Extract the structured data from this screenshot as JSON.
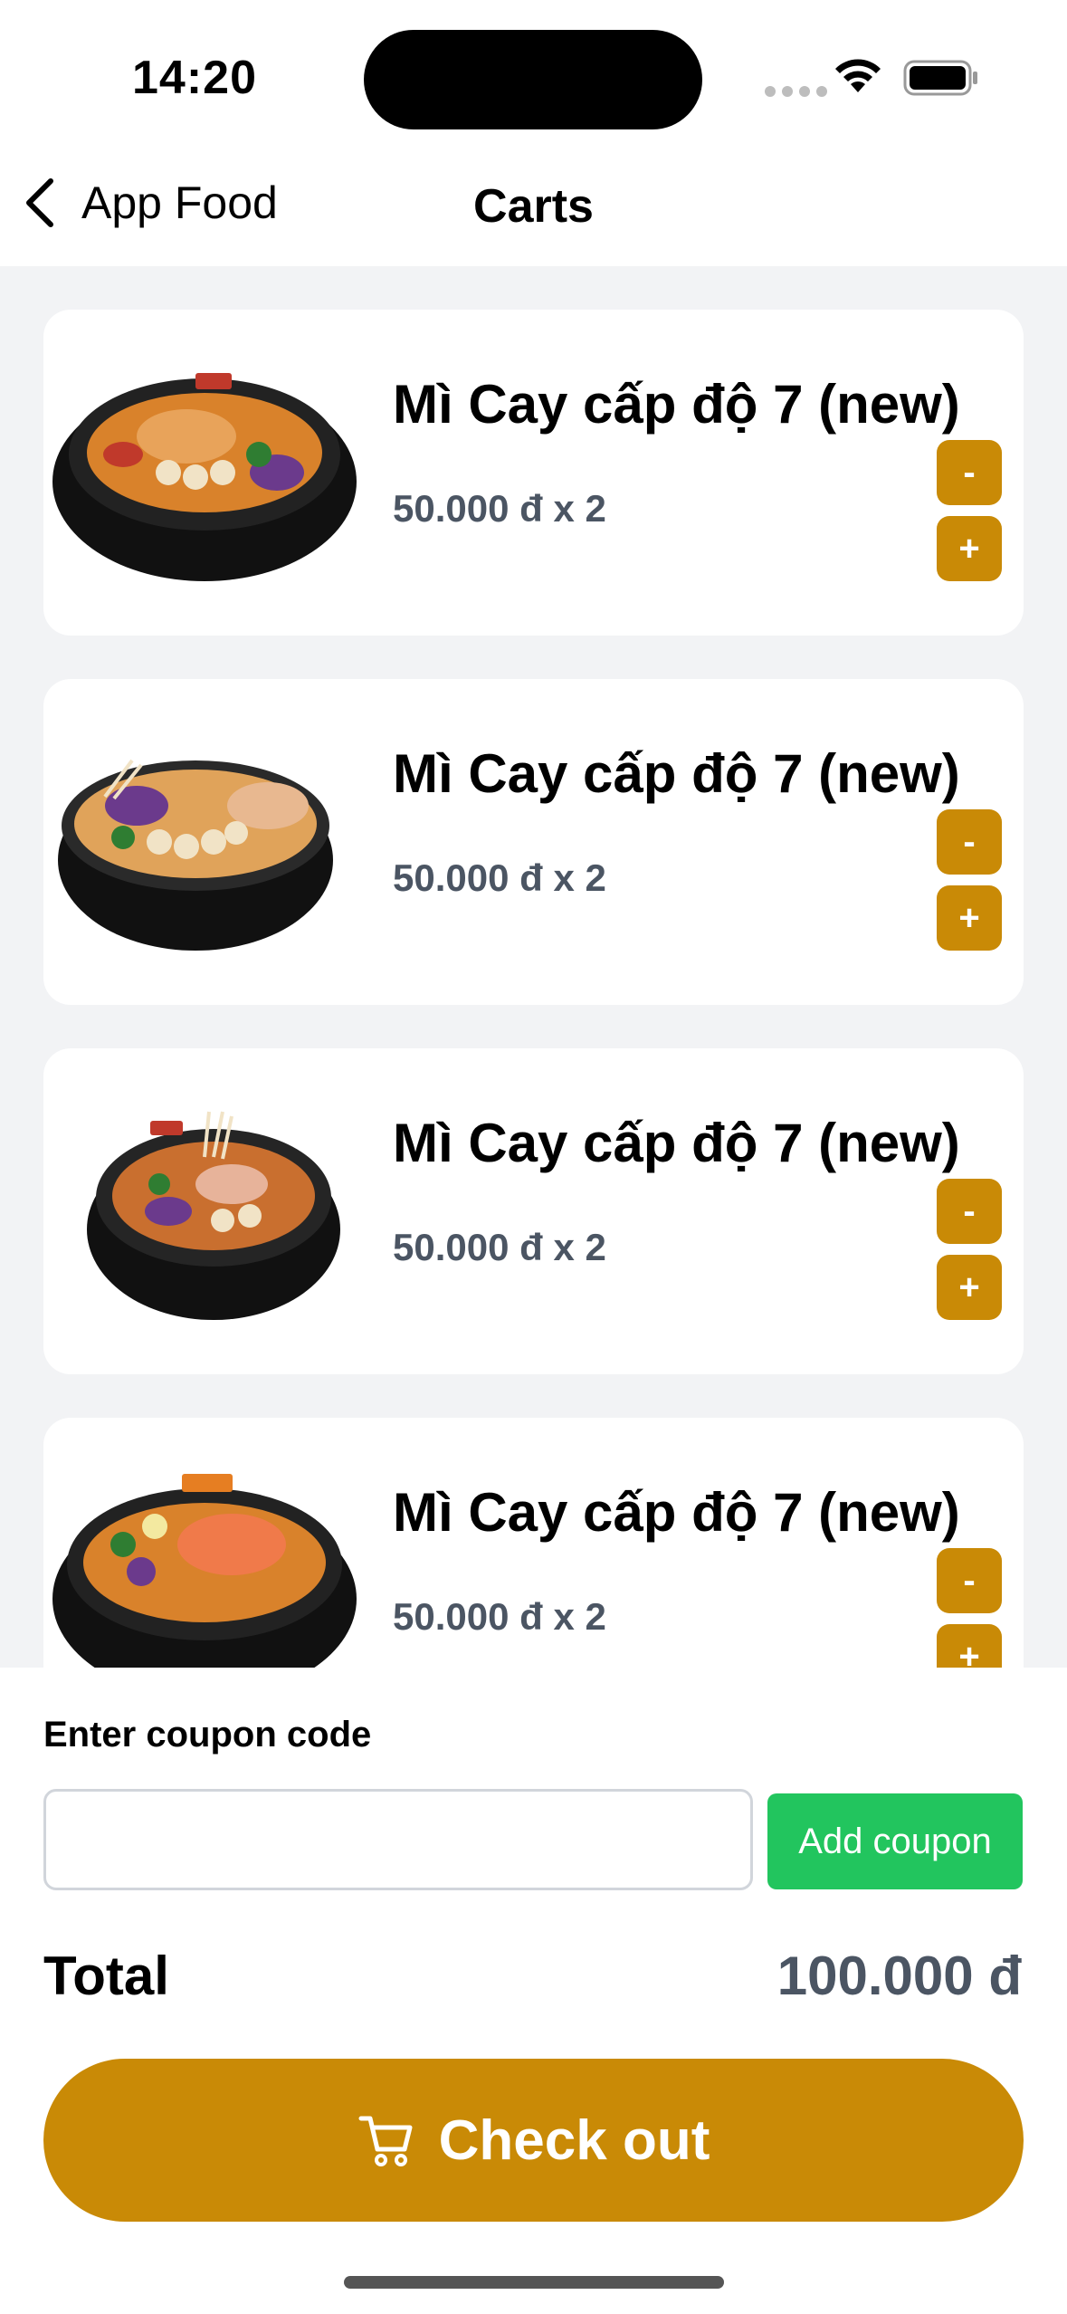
{
  "status_bar": {
    "time": "14:20"
  },
  "nav": {
    "back_label": "App Food",
    "title": "Carts"
  },
  "cart": {
    "items": [
      {
        "name": "Mì Cay cấp độ 7 (new)",
        "price_line": "50.000 đ x 2",
        "minus": "-",
        "plus": "+"
      },
      {
        "name": "Mì Cay cấp độ 7 (new)",
        "price_line": "50.000 đ x 2",
        "minus": "-",
        "plus": "+"
      },
      {
        "name": "Mì Cay cấp độ 7 (new)",
        "price_line": "50.000 đ x 2",
        "minus": "-",
        "plus": "+"
      },
      {
        "name": "Mì Cay cấp độ 7 (new)",
        "price_line": "50.000 đ x 2",
        "minus": "-",
        "plus": "+"
      }
    ]
  },
  "coupon": {
    "label": "Enter coupon code",
    "value": "",
    "button_label": "Add coupon"
  },
  "total": {
    "label": "Total",
    "value": "100.000 đ"
  },
  "checkout": {
    "label": "Check out",
    "icon": "cart-icon"
  },
  "colors": {
    "accent": "#c98a06",
    "coupon_button": "#22c55e",
    "background": "#f2f3f5"
  }
}
